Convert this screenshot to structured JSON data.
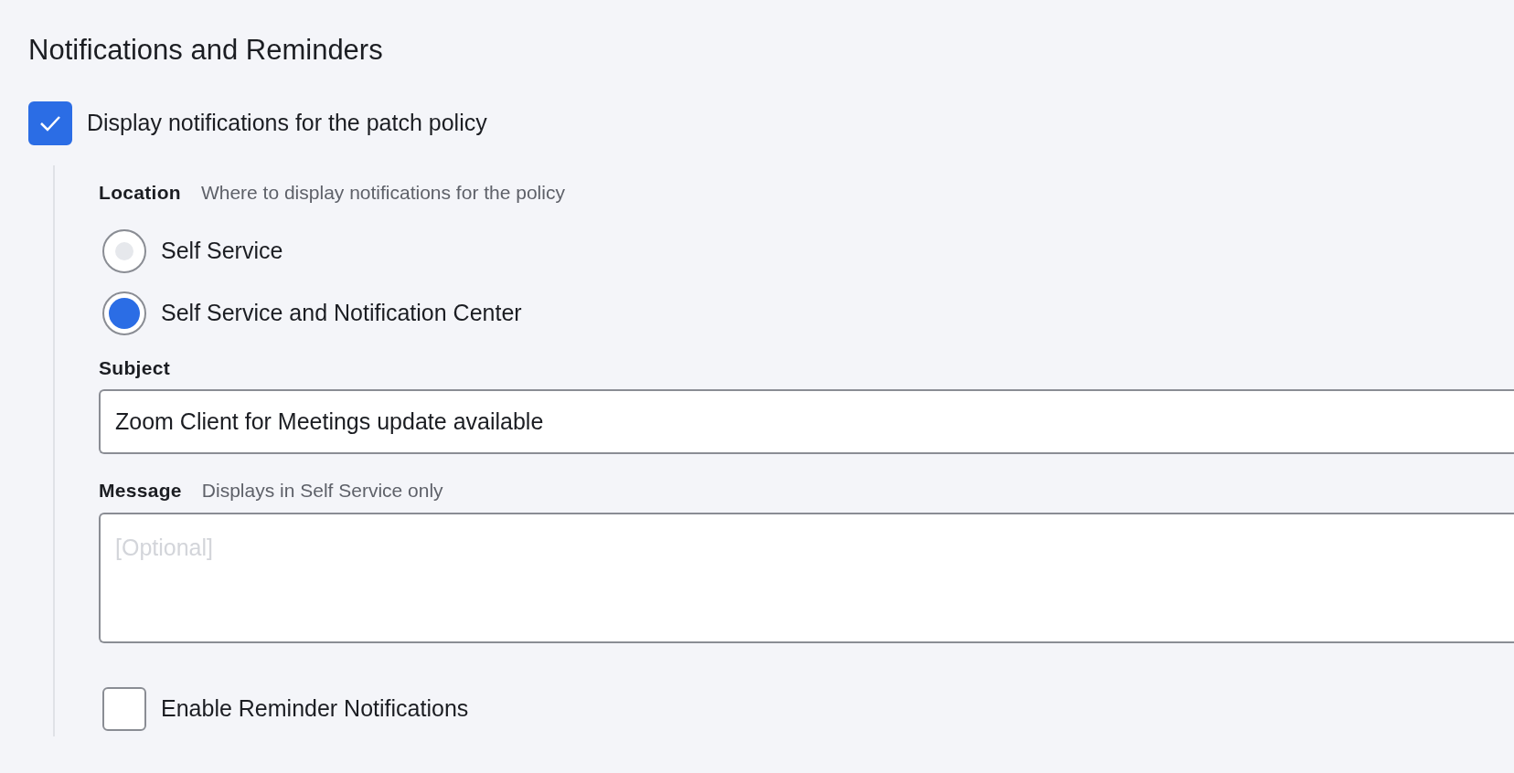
{
  "section": {
    "title": "Notifications and Reminders"
  },
  "display_notifications": {
    "label": "Display notifications for the patch policy",
    "checked": true
  },
  "location": {
    "label": "Location",
    "hint": "Where to display notifications for the policy",
    "options": [
      {
        "label": "Self Service",
        "selected": false
      },
      {
        "label": "Self Service and Notification Center",
        "selected": true
      }
    ]
  },
  "subject": {
    "label": "Subject",
    "value": "Zoom Client for Meetings update available"
  },
  "message": {
    "label": "Message",
    "hint": "Displays in Self Service only",
    "placeholder": "[Optional]"
  },
  "reminder": {
    "label": "Enable Reminder Notifications",
    "checked": false
  }
}
